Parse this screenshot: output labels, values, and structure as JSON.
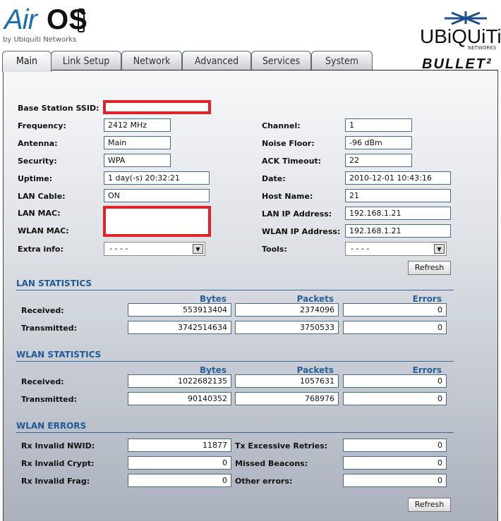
{
  "header": {
    "logo_air": "Air",
    "logo_os": "OS",
    "logo_by": "by Ubiquiti Networks",
    "brand": "UBiQUiTi",
    "brand_sub": "NETWORKS",
    "product": "BULLET²"
  },
  "tabs": [
    "Main",
    "Link Setup",
    "Network",
    "Advanced",
    "Services",
    "System"
  ],
  "left": [
    {
      "label": "Frequency:",
      "value": "2412 MHz"
    },
    {
      "label": "Antenna:",
      "value": "Main"
    },
    {
      "label": "Security:",
      "value": "WPA"
    },
    {
      "label": "Uptime:",
      "value": "1 day(-s) 20:32:21"
    },
    {
      "label": "LAN Cable:",
      "value": "ON"
    }
  ],
  "right": [
    {
      "label": "Channel:",
      "value": "1"
    },
    {
      "label": "Noise Floor:",
      "value": "-96 dBm"
    },
    {
      "label": "ACK Timeout:",
      "value": "22"
    },
    {
      "label": "Date:",
      "value": "2010-12-01 10:43:16"
    },
    {
      "label": "Host Name:",
      "value": "21"
    },
    {
      "label": "LAN IP Address:",
      "value": "192.168.1.21"
    },
    {
      "label": "WLAN IP Address:",
      "value": "192.168.1.21"
    }
  ],
  "ssid_label": "Base Station SSID:",
  "lan_mac_label": "LAN MAC:",
  "wlan_mac_label": "WLAN MAC:",
  "extra_label": "Extra info:",
  "extra_value": "- - - -",
  "tools_label": "Tools:",
  "tools_value": "- - - -",
  "refresh": "Refresh",
  "cols": [
    "Bytes",
    "Packets",
    "Errors"
  ],
  "lan": {
    "title": "LAN STATISTICS",
    "rows": [
      {
        "label": "Received:",
        "v": [
          "553913404",
          "2374096",
          "0"
        ]
      },
      {
        "label": "Transmitted:",
        "v": [
          "3742514634",
          "3750533",
          "0"
        ]
      }
    ]
  },
  "wlan": {
    "title": "WLAN STATISTICS",
    "rows": [
      {
        "label": "Received:",
        "v": [
          "1022682135",
          "1057631",
          "0"
        ]
      },
      {
        "label": "Transmitted:",
        "v": [
          "90140352",
          "768976",
          "0"
        ]
      }
    ]
  },
  "errors": {
    "title": "WLAN ERRORS",
    "rows": [
      {
        "l1": "Rx Invalid NWID:",
        "v1": "11877",
        "l2": "Tx Excessive Retries:",
        "v2": "0"
      },
      {
        "l1": "Rx Invalid Crypt:",
        "v1": "0",
        "l2": "Missed Beacons:",
        "v2": "0"
      },
      {
        "l1": "Rx Invalid Frag:",
        "v1": "0",
        "l2": "Other errors:",
        "v2": "0"
      }
    ]
  }
}
